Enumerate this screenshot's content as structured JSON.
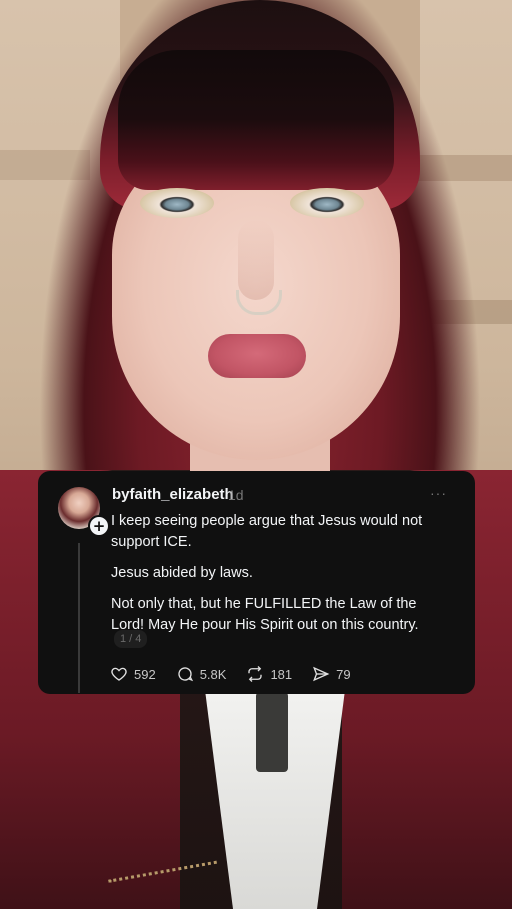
{
  "post": {
    "username": "byfaith_elizabeth",
    "time": "1d",
    "more": "···",
    "avatar_plus": "+",
    "paragraphs": [
      "I keep seeing people argue that Jesus would not support ICE.",
      "Jesus abided by laws.",
      "Not only that, but he FULFILLED the Law of the Lord! May He pour His Spirit out on this country."
    ],
    "pager": "1 / 4",
    "actions": {
      "likes": "592",
      "replies": "5.8K",
      "reposts": "181",
      "shares": "79"
    }
  },
  "colors": {
    "card_bg": "#101010",
    "text": "#f3f5f7",
    "muted": "#777777",
    "hair": "#8b2430"
  },
  "icons": [
    "heart-icon",
    "comment-icon",
    "repost-icon",
    "share-icon",
    "plus-icon",
    "more-icon"
  ]
}
